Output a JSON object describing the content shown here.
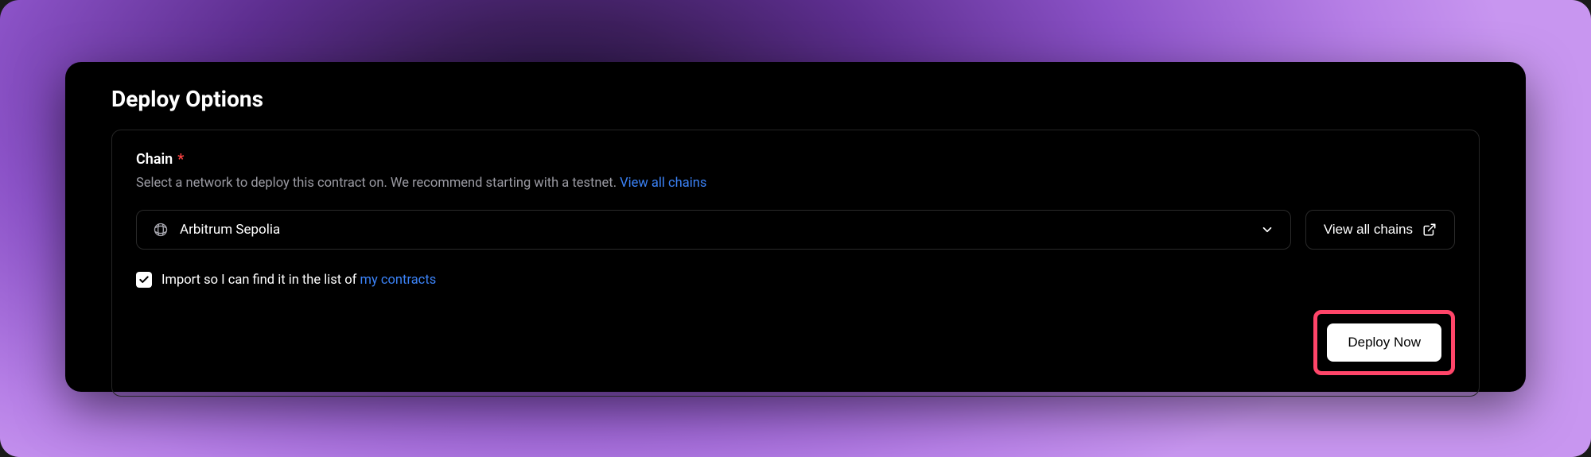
{
  "panel": {
    "title": "Deploy Options"
  },
  "chain_field": {
    "label": "Chain",
    "required_mark": "*",
    "help_text": "Select a network to deploy this contract on. We recommend starting with a testnet. ",
    "help_link_text": "View all chains",
    "selected_value": "Arbitrum Sepolia"
  },
  "view_all_button": {
    "label": "View all chains"
  },
  "import_checkbox": {
    "checked": true,
    "label_prefix": "Import so I can find it in the list of ",
    "label_link": "my contracts"
  },
  "deploy_button": {
    "label": "Deploy Now"
  },
  "colors": {
    "accent_highlight": "#ff4569",
    "link": "#3b82f6",
    "required": "#ff4444"
  }
}
